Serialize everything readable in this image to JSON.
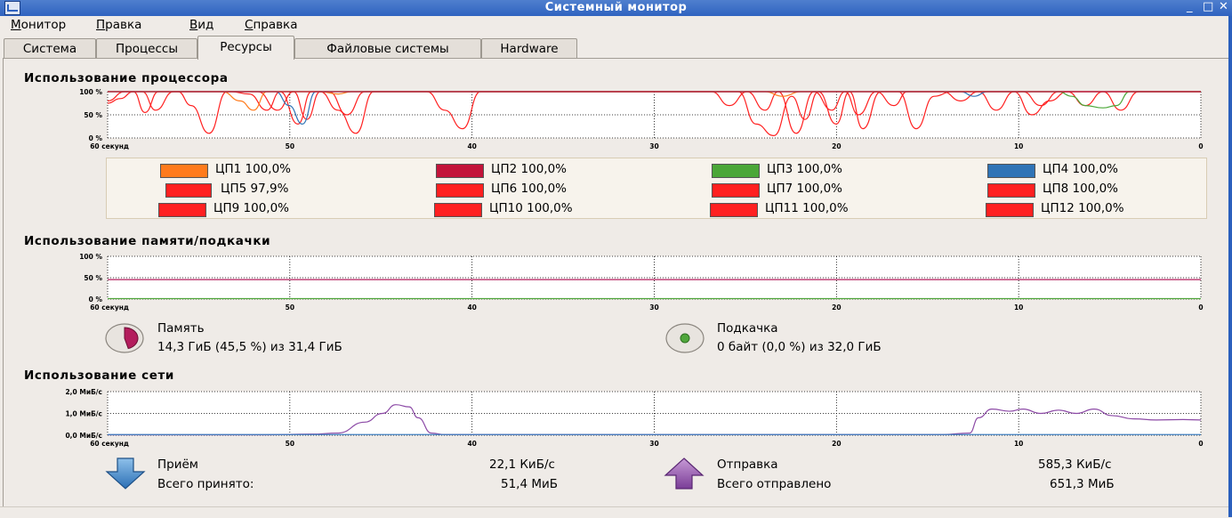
{
  "window": {
    "title": "Системный монитор",
    "minimize": "_",
    "maximize": "□",
    "close": "✕"
  },
  "menu": {
    "items": [
      {
        "accel": "М",
        "rest": "онитор"
      },
      {
        "accel": "П",
        "rest": "равка"
      },
      {
        "accel": "В",
        "rest": "ид"
      },
      {
        "accel": "С",
        "rest": "правка"
      }
    ]
  },
  "tabs": [
    "Система",
    "Процессы",
    "Ресурсы",
    "Файловые системы",
    "Hardware"
  ],
  "active_tab": "Ресурсы",
  "cpu": {
    "title": "Использование процессора",
    "y_ticks": [
      "100 %",
      "50 %",
      "0 %"
    ],
    "x_ticks": [
      "60 секунд",
      "50",
      "40",
      "30",
      "20",
      "10",
      "0"
    ],
    "cpus": [
      {
        "name": "ЦП1",
        "value": "100,0%",
        "color": "#ff7b1c"
      },
      {
        "name": "ЦП2",
        "value": "100,0%",
        "color": "#c3143a"
      },
      {
        "name": "ЦП3",
        "value": "100,0%",
        "color": "#4ba738"
      },
      {
        "name": "ЦП4",
        "value": "100,0%",
        "color": "#3074b6"
      },
      {
        "name": "ЦП5",
        "value": "97,9%",
        "color": "#ff2020"
      },
      {
        "name": "ЦП6",
        "value": "100,0%",
        "color": "#ff2020"
      },
      {
        "name": "ЦП7",
        "value": "100,0%",
        "color": "#ff2020"
      },
      {
        "name": "ЦП8",
        "value": "100,0%",
        "color": "#ff2020"
      },
      {
        "name": "ЦП9",
        "value": "100,0%",
        "color": "#ff2020"
      },
      {
        "name": "ЦП10",
        "value": "100,0%",
        "color": "#ff2020"
      },
      {
        "name": "ЦП11",
        "value": "100,0%",
        "color": "#ff2020"
      },
      {
        "name": "ЦП12",
        "value": "100,0%",
        "color": "#ff2020"
      }
    ]
  },
  "memory": {
    "title": "Использование памяти/подкачки",
    "y_ticks": [
      "100 %",
      "50 %",
      "0 %"
    ],
    "x_ticks": [
      "60 секунд",
      "50",
      "40",
      "30",
      "20",
      "10",
      "0"
    ],
    "mem_label": "Память",
    "mem_value": "14,3 ГиБ (45,5 %) из 31,4 ГиБ",
    "mem_fraction": 0.455,
    "swap_label": "Подкачка",
    "swap_value": "0 байт (0,0 %) из 32,0 ГиБ",
    "swap_fraction": 0.0,
    "mem_color": "#b31d5c",
    "swap_color": "#4fa63b"
  },
  "network": {
    "title": "Использование сети",
    "y_ticks": [
      "2,0 МиБ/с",
      "1,0 МиБ/с",
      "0,0 МиБ/с"
    ],
    "x_ticks": [
      "60 секунд",
      "50",
      "40",
      "30",
      "20",
      "10",
      "0"
    ],
    "recv_label": "Приём",
    "recv_rate": "22,1 КиБ/с",
    "recv_total_label": "Всего принято:",
    "recv_total": "51,4 МиБ",
    "send_label": "Отправка",
    "send_rate": "585,3 КиБ/с",
    "send_total_label": "Всего отправлено",
    "send_total": "651,3 МиБ",
    "recv_color": "#3f7fbf",
    "send_color": "#8c4aa6"
  }
}
